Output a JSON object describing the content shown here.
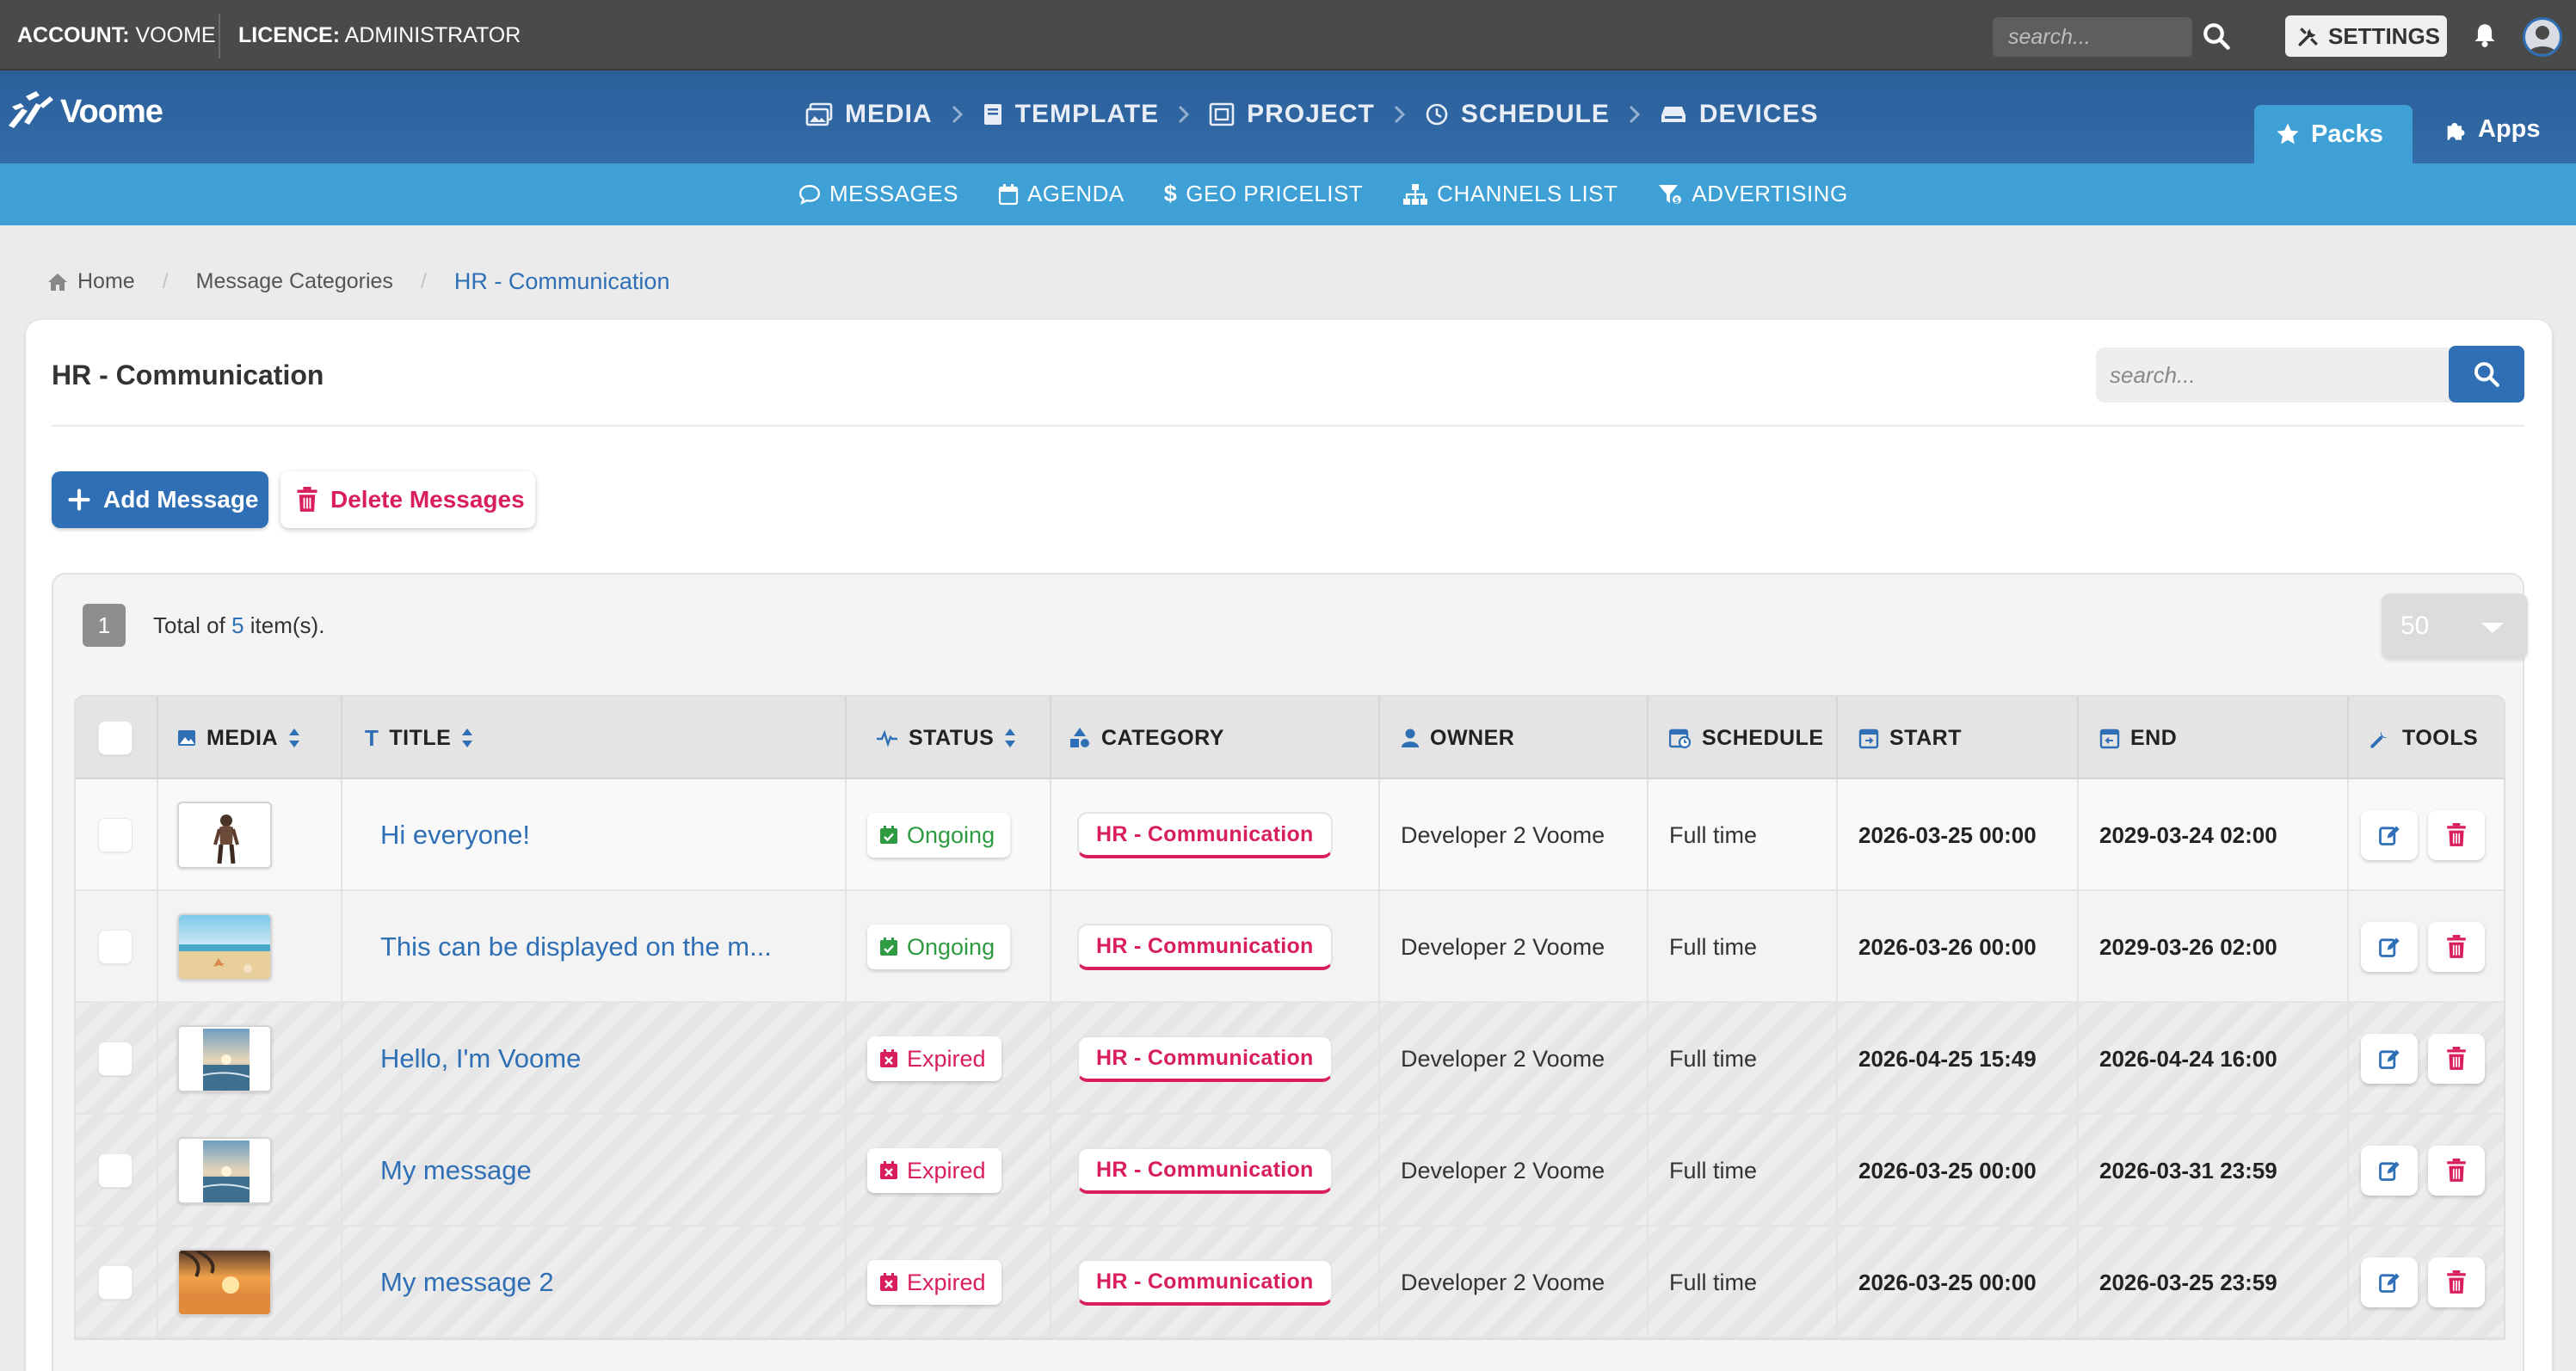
{
  "topbar": {
    "account_label": "ACCOUNT:",
    "account_value": "VOOME",
    "licence_label": "LICENCE:",
    "licence_value": "ADMINISTRATOR",
    "search_placeholder": "search...",
    "settings_label": "SETTINGS"
  },
  "logo": {
    "text": "Voome"
  },
  "main_nav": {
    "steps": [
      {
        "label": "MEDIA",
        "icon": "images-icon"
      },
      {
        "label": "TEMPLATE",
        "icon": "book-icon"
      },
      {
        "label": "PROJECT",
        "icon": "project-icon"
      },
      {
        "label": "SCHEDULE",
        "icon": "clock-icon"
      },
      {
        "label": "DEVICES",
        "icon": "device-icon"
      }
    ],
    "tabs": [
      {
        "label": "Packs",
        "icon": "star-icon",
        "active": true
      },
      {
        "label": "Apps",
        "icon": "puzzle-icon",
        "active": false
      }
    ]
  },
  "sub_nav": {
    "items": [
      {
        "label": "MESSAGES",
        "icon": "comment-icon"
      },
      {
        "label": "AGENDA",
        "icon": "calendar-icon"
      },
      {
        "label": "GEO PRICELIST",
        "icon": "dollar-icon"
      },
      {
        "label": "CHANNELS LIST",
        "icon": "sitemap-icon"
      },
      {
        "label": "ADVERTISING",
        "icon": "funnel-icon"
      }
    ]
  },
  "breadcrumb": {
    "items": [
      {
        "label": "Home",
        "icon": "home-icon"
      },
      {
        "label": "Message Categories"
      },
      {
        "label": "HR - Communication",
        "active": true
      }
    ]
  },
  "card": {
    "title": "HR - Communication",
    "search_placeholder": "search...",
    "add_button": "Add Message",
    "delete_button": "Delete Messages"
  },
  "list": {
    "page": "1",
    "total_prefix": "Total of",
    "total_count": "5",
    "total_suffix": "item(s).",
    "per_page": "50",
    "columns": {
      "media": "MEDIA",
      "title": "TITLE",
      "status": "STATUS",
      "category": "CATEGORY",
      "owner": "OWNER",
      "schedule": "SCHEDULE",
      "start": "START",
      "end": "END",
      "tools": "TOOLS"
    },
    "rows": [
      {
        "thumb": "person",
        "title": "Hi everyone!",
        "status": "Ongoing",
        "category": "HR - Communication",
        "owner": "Developer 2 Voome",
        "schedule": "Full time",
        "start": "2026-03-25 00:00",
        "end": "2029-03-24 02:00"
      },
      {
        "thumb": "beach",
        "title": "This can be displayed on the m...",
        "status": "Ongoing",
        "category": "HR - Communication",
        "owner": "Developer 2 Voome",
        "schedule": "Full time",
        "start": "2026-03-26 00:00",
        "end": "2029-03-26 02:00"
      },
      {
        "thumb": "sea",
        "title": "Hello, I'm Voome",
        "status": "Expired",
        "category": "HR - Communication",
        "owner": "Developer 2 Voome",
        "schedule": "Full time",
        "start": "2026-04-25 15:49",
        "end": "2026-04-24 16:00"
      },
      {
        "thumb": "sea",
        "title": "My message",
        "status": "Expired",
        "category": "HR - Communication",
        "owner": "Developer 2 Voome",
        "schedule": "Full time",
        "start": "2026-03-25 00:00",
        "end": "2026-03-31 23:59"
      },
      {
        "thumb": "sunset",
        "title": "My message 2",
        "status": "Expired",
        "category": "HR - Communication",
        "owner": "Developer 2 Voome",
        "schedule": "Full time",
        "start": "2026-03-25 00:00",
        "end": "2026-03-25 23:59"
      }
    ]
  },
  "colors": {
    "primary": "#2f6fb5",
    "subnav": "#3ea0d4",
    "ongoing": "#2e9a41",
    "expired": "#d81e5b",
    "category": "#d81e5b"
  }
}
